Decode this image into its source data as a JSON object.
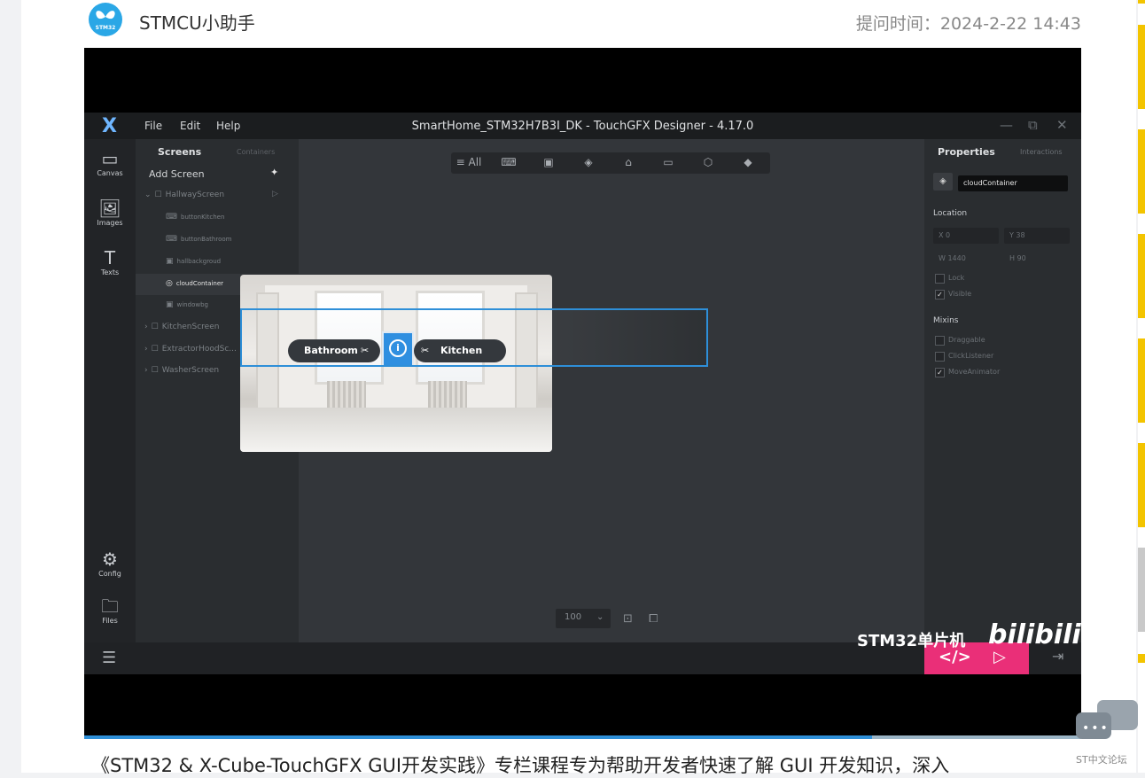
{
  "post": {
    "author": "STMCU小助手",
    "avatar_text": "STM32",
    "ask_time": "提问时间：2024-2-22 14:43",
    "description": "《STM32 & X-Cube-TouchGFX GUI开发实践》专栏课程专为帮助开发者快速了解 GUI 开发知识，深入"
  },
  "video": {
    "progress_percent": 79,
    "watermark": "STM32单片机",
    "platform_logo": "bilibili",
    "pink_icons": [
      "</>",
      "▷"
    ]
  },
  "app": {
    "logo": "X",
    "menu": [
      "File",
      "Edit",
      "Help"
    ],
    "window_title": "SmartHome_STM32H7B3I_DK - TouchGFX Designer - 4.17.0",
    "window_controls": [
      "—",
      "⧉",
      "✕"
    ],
    "rail": [
      {
        "icon": "▭",
        "label": "Canvas"
      },
      {
        "icon": "🖼",
        "label": "Images"
      },
      {
        "icon": "T",
        "label": "Texts"
      },
      {
        "icon": "⚙",
        "label": "Config"
      },
      {
        "icon": "🗀",
        "label": "Files"
      }
    ],
    "screens_panel": {
      "tab_screens": "Screens",
      "tab_containers": "Containers",
      "add_screen": "Add Screen",
      "add_icon": "✦",
      "tree": [
        {
          "label": "HallwayScreen",
          "icon": "☐",
          "caret": "⌄"
        },
        {
          "label": "buttonKitchen",
          "icon": "⌨"
        },
        {
          "label": "buttonBathroom",
          "icon": "⌨"
        },
        {
          "label": "hallbackgroud",
          "icon": "▣"
        },
        {
          "label": "cloudContainer",
          "icon": "◎"
        },
        {
          "label": "windowbg",
          "icon": "▣"
        },
        {
          "label": "KitchenScreen",
          "icon": "☐",
          "caret": "›"
        },
        {
          "label": "ExtractorHoodSc...",
          "icon": "☐",
          "caret": "›"
        },
        {
          "label": "WasherScreen",
          "icon": "☐",
          "caret": "›"
        }
      ]
    },
    "toolbar": [
      "≡ All",
      "⌨",
      "▣",
      "◈",
      "⌂",
      "▭",
      "⬡",
      "◆"
    ],
    "zoom": {
      "value": "100",
      "arrow": "⌄",
      "fit_icon": "⊡",
      "crop_icon": "⧠"
    },
    "scene": {
      "left_button": "Bathroom",
      "right_button": "Kitchen",
      "info": "i",
      "left_icon": "✂",
      "right_icon": "✂"
    },
    "properties": {
      "tab_properties": "Properties",
      "tab_interactions": "Interactions",
      "name": "cloudContainer",
      "location_label": "Location",
      "x": "X  0",
      "y": "Y  38",
      "w": "W  1440",
      "h": "H  90",
      "lock": "Lock",
      "visible": "Visible",
      "mixins_label": "Mixins",
      "mixins": [
        {
          "label": "Draggable",
          "checked": false
        },
        {
          "label": "ClickListener",
          "checked": false
        },
        {
          "label": "MoveAnimator",
          "checked": true
        }
      ]
    },
    "bottom": {
      "menu_icon": "☰",
      "exit_icon": "⇥"
    }
  },
  "forum": {
    "label": "ST中文论坛",
    "dots": "•••"
  },
  "colors": {
    "accent": "#2e8fd8",
    "pink": "#ea2f78",
    "strip": "#f3c400"
  }
}
